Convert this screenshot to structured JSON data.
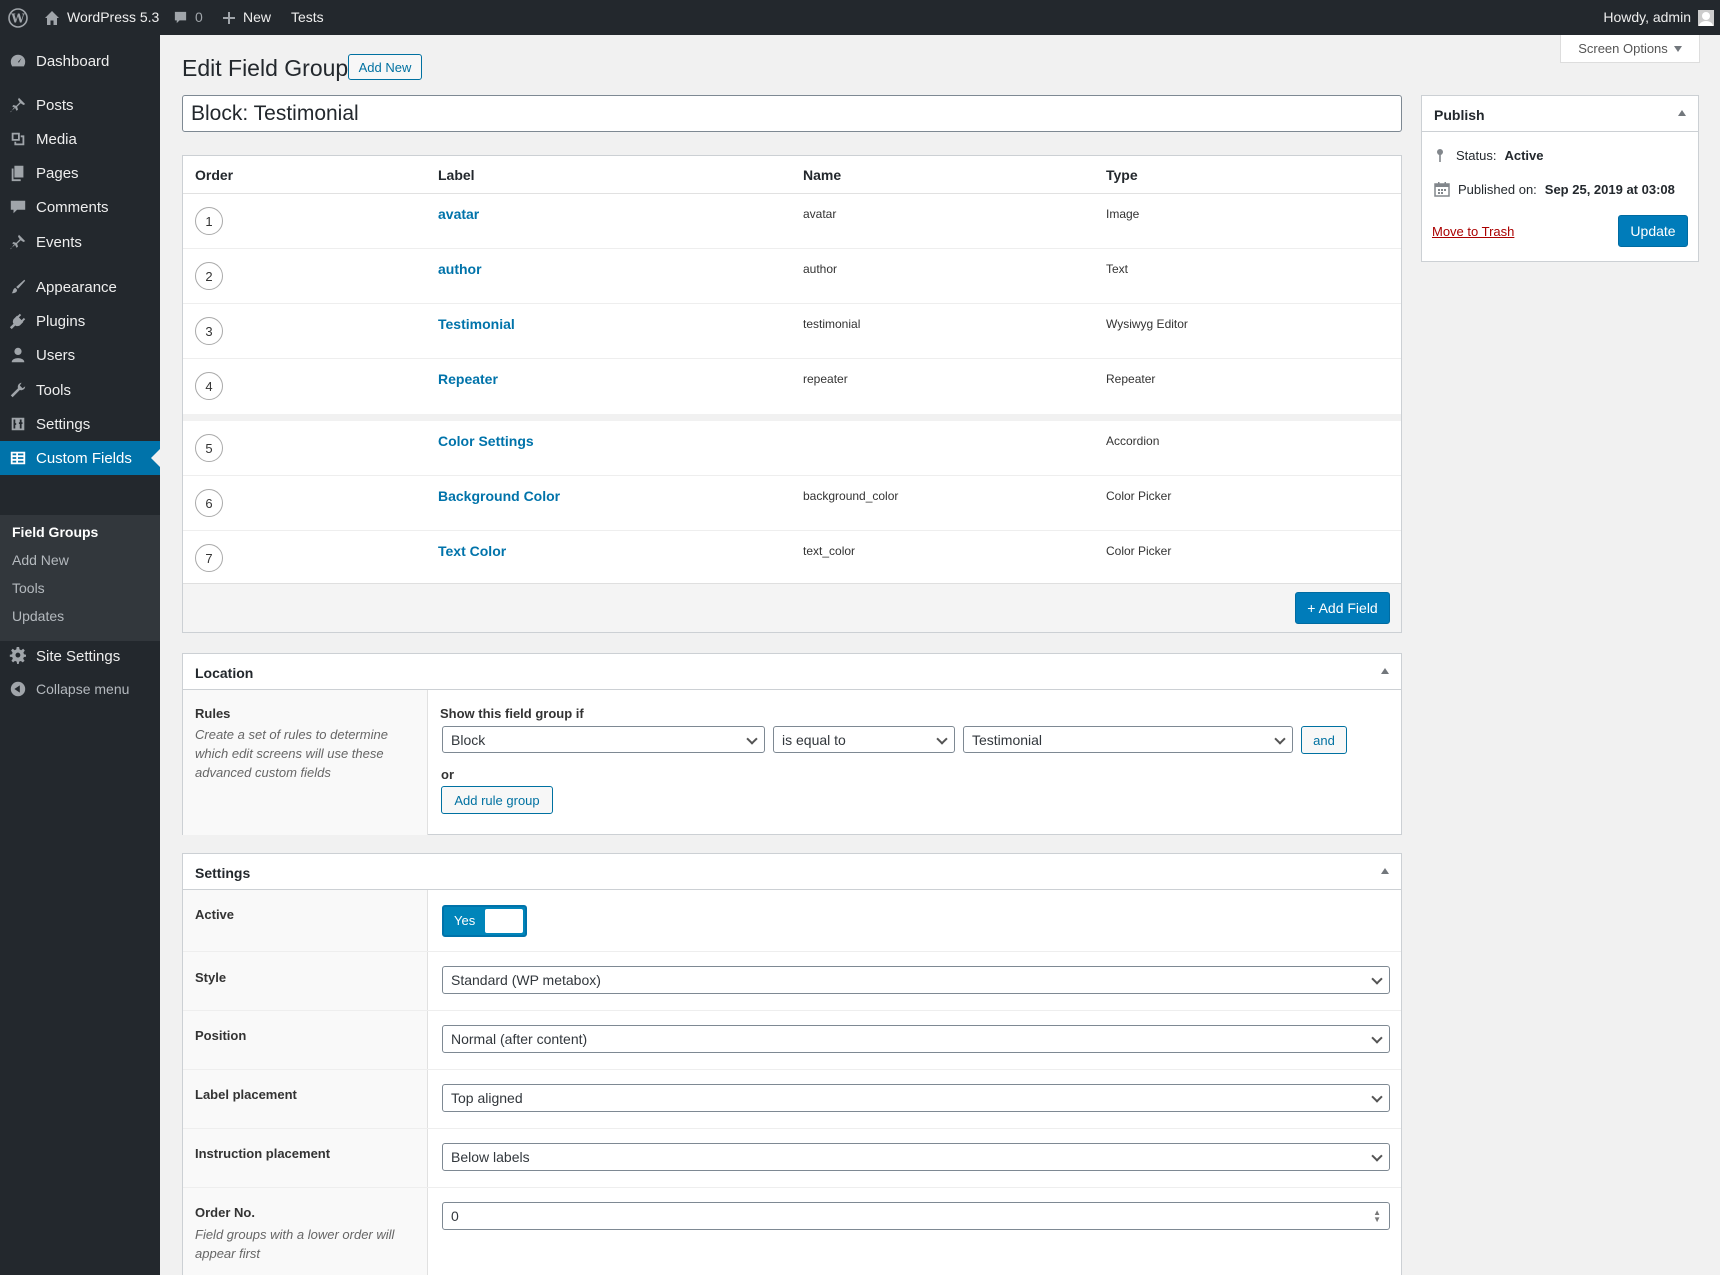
{
  "adminbar": {
    "site_name": "WordPress 5.3",
    "comments_count": "0",
    "new_label": "New",
    "tests_label": "Tests",
    "howdy": "Howdy, admin"
  },
  "sidebar": {
    "items": [
      {
        "label": "Dashboard",
        "icon": "dashboard-icon"
      },
      {
        "label": "Posts",
        "icon": "pin-icon"
      },
      {
        "label": "Media",
        "icon": "media-icon"
      },
      {
        "label": "Pages",
        "icon": "pages-icon"
      },
      {
        "label": "Comments",
        "icon": "comment-icon"
      },
      {
        "label": "Events",
        "icon": "pin-icon"
      },
      {
        "label": "Appearance",
        "icon": "brush-icon"
      },
      {
        "label": "Plugins",
        "icon": "plug-icon"
      },
      {
        "label": "Users",
        "icon": "user-icon"
      },
      {
        "label": "Tools",
        "icon": "wrench-icon"
      },
      {
        "label": "Settings",
        "icon": "sliders-icon"
      },
      {
        "label": "Custom Fields",
        "icon": "table-icon"
      },
      {
        "label": "Site Settings",
        "icon": "gear-icon"
      },
      {
        "label": "Collapse menu",
        "icon": "collapse-icon"
      }
    ],
    "submenu": [
      "Field Groups",
      "Add New",
      "Tools",
      "Updates"
    ]
  },
  "header": {
    "screen_options": "Screen Options",
    "title": "Edit Field Group",
    "add_new": "Add New"
  },
  "field_group_title": "Block: Testimonial",
  "fields_table": {
    "columns": [
      "Order",
      "Label",
      "Name",
      "Type"
    ],
    "rows": [
      {
        "order": "1",
        "label": "avatar",
        "name": "avatar",
        "type": "Image"
      },
      {
        "order": "2",
        "label": "author",
        "name": "author",
        "type": "Text"
      },
      {
        "order": "3",
        "label": "Testimonial",
        "name": "testimonial",
        "type": "Wysiwyg Editor"
      },
      {
        "order": "4",
        "label": "Repeater",
        "name": "repeater",
        "type": "Repeater"
      },
      {
        "order": "5",
        "label": "Color Settings",
        "name": "",
        "type": "Accordion"
      },
      {
        "order": "6",
        "label": "Background Color",
        "name": "background_color",
        "type": "Color Picker"
      },
      {
        "order": "7",
        "label": "Text Color",
        "name": "text_color",
        "type": "Color Picker"
      }
    ],
    "add_field": "+ Add Field"
  },
  "publish": {
    "title": "Publish",
    "status_label": "Status:",
    "status_value": "Active",
    "published_label": "Published on:",
    "published_value": "Sep 25, 2019 at 03:08",
    "trash": "Move to Trash",
    "update": "Update"
  },
  "location": {
    "title": "Location",
    "rules_label": "Rules",
    "rules_desc": "Create a set of rules to determine which edit screens will use these advanced custom fields",
    "show_if": "Show this field group if",
    "param": "Block",
    "operator": "is equal to",
    "value": "Testimonial",
    "and": "and",
    "or": "or",
    "add_rule_group": "Add rule group"
  },
  "settings": {
    "title": "Settings",
    "active_label": "Active",
    "active_value": "Yes",
    "style_label": "Style",
    "style_value": "Standard (WP metabox)",
    "position_label": "Position",
    "position_value": "Normal (after content)",
    "label_placement_label": "Label placement",
    "label_placement_value": "Top aligned",
    "instruction_placement_label": "Instruction placement",
    "instruction_placement_value": "Below labels",
    "order_label": "Order No.",
    "order_desc": "Field groups with a lower order will appear first",
    "order_value": "0"
  }
}
